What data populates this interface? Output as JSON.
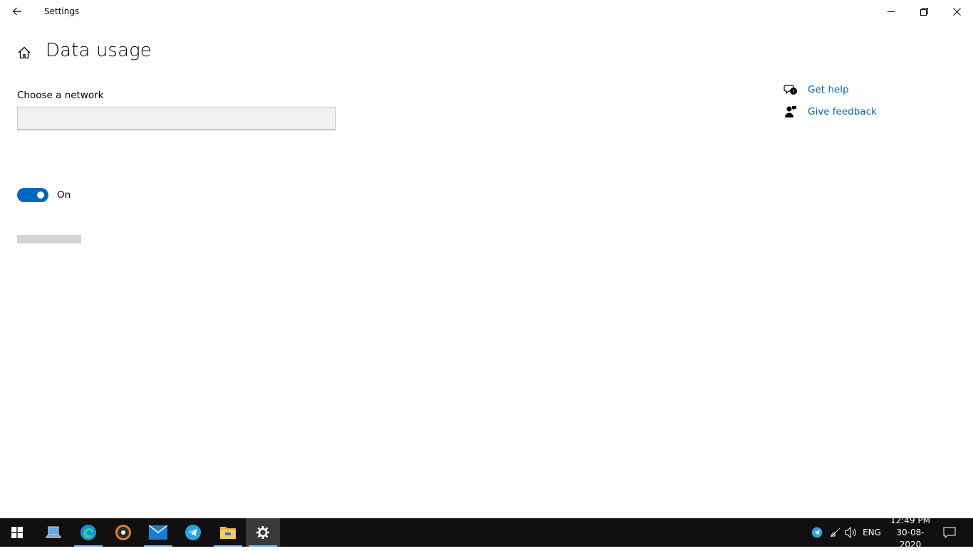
{
  "window": {
    "title": "Settings"
  },
  "page": {
    "title": "Data usage"
  },
  "network": {
    "label": "Choose a network",
    "selected_value": ""
  },
  "toggle": {
    "state_label": "On",
    "checked": true
  },
  "help_links": {
    "get_help": "Get help",
    "give_feedback": "Give feedback"
  },
  "colors": {
    "accent": "#0067c0",
    "link": "#0067b8",
    "taskbar": "#101010"
  },
  "taskbar": {
    "apps": [
      {
        "name": "start",
        "icon": "windows-logo-icon"
      },
      {
        "name": "this-pc",
        "icon": "laptop-icon"
      },
      {
        "name": "edge",
        "icon": "edge-icon"
      },
      {
        "name": "media",
        "icon": "media-player-icon"
      },
      {
        "name": "mail",
        "icon": "mail-icon"
      },
      {
        "name": "telegram",
        "icon": "telegram-icon"
      },
      {
        "name": "file-explorer",
        "icon": "folder-icon"
      },
      {
        "name": "settings",
        "icon": "gear-icon"
      }
    ],
    "language": "ENG",
    "time": "12:49 PM",
    "date": "30-08-2020"
  }
}
